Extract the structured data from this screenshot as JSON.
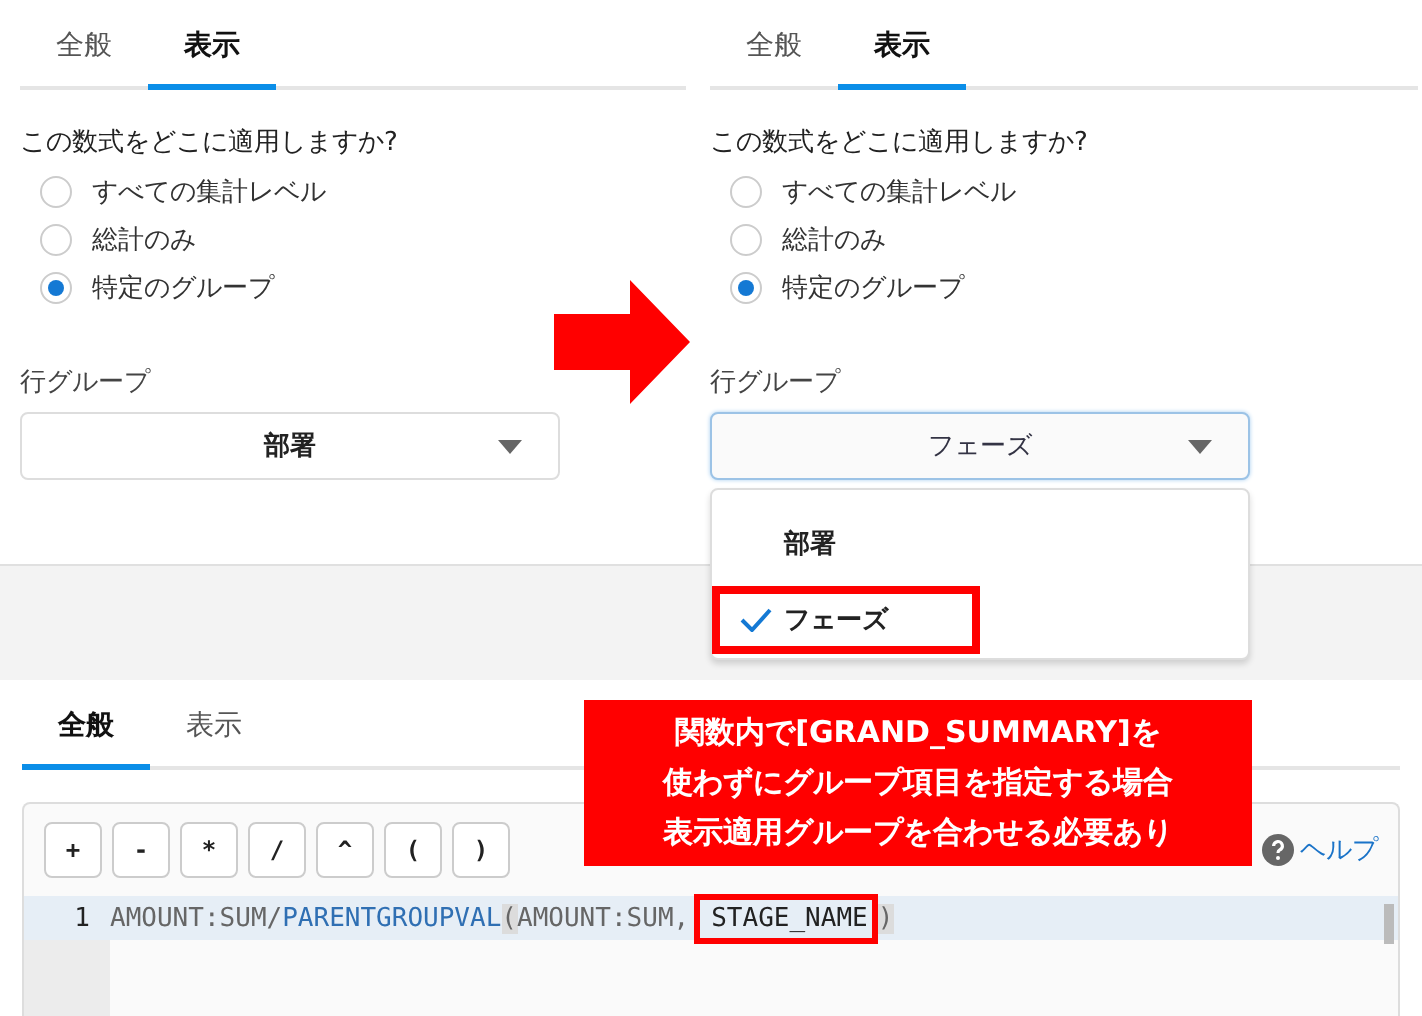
{
  "panels": [
    {
      "tabs": [
        {
          "label": "全般",
          "selected": false
        },
        {
          "label": "表示",
          "selected": true
        }
      ],
      "question": "この数式をどこに適用しますか?",
      "options": [
        {
          "label": "すべての集計レベル",
          "selected": false
        },
        {
          "label": "総計のみ",
          "selected": false
        },
        {
          "label": "特定のグループ",
          "selected": true
        }
      ],
      "group_label": "行グループ",
      "group_value": "部署",
      "focused": false
    },
    {
      "tabs": [
        {
          "label": "全般",
          "selected": false
        },
        {
          "label": "表示",
          "selected": true
        }
      ],
      "question": "この数式をどこに適用しますか?",
      "options": [
        {
          "label": "すべての集計レベル",
          "selected": false
        },
        {
          "label": "総計のみ",
          "selected": false
        },
        {
          "label": "特定のグループ",
          "selected": true
        }
      ],
      "group_label": "行グループ",
      "group_value": "フェーズ",
      "focused": true,
      "menu": [
        {
          "label": "部署",
          "selected": false,
          "highlighted": false
        },
        {
          "label": "フェーズ",
          "selected": true,
          "highlighted": true
        }
      ]
    }
  ],
  "editor": {
    "tabs": [
      {
        "label": "全般",
        "selected": true
      },
      {
        "label": "表示",
        "selected": false
      }
    ],
    "operators": [
      "+",
      "-",
      "*",
      "/",
      "^",
      "(",
      ")"
    ],
    "help": "ヘルプ",
    "lines": [
      {
        "number": "1",
        "tokens": [
          {
            "text": "AMOUNT:SUM/",
            "kind": "plain"
          },
          {
            "text": "PARENTGROUPVAL",
            "kind": "function"
          },
          {
            "text": "(",
            "kind": "bracket"
          },
          {
            "text": "AMOUNT:SUM,",
            "kind": "plain"
          },
          {
            "text": "STAGE_NAME",
            "kind": "highlighted"
          },
          {
            "text": ")",
            "kind": "bracket"
          }
        ]
      }
    ]
  },
  "callout": {
    "lines": [
      "関数内で[GRAND_SUMMARY]を",
      "使わずにグループ項目を指定する場合",
      "表示適用グループを合わせる必要あり"
    ]
  }
}
